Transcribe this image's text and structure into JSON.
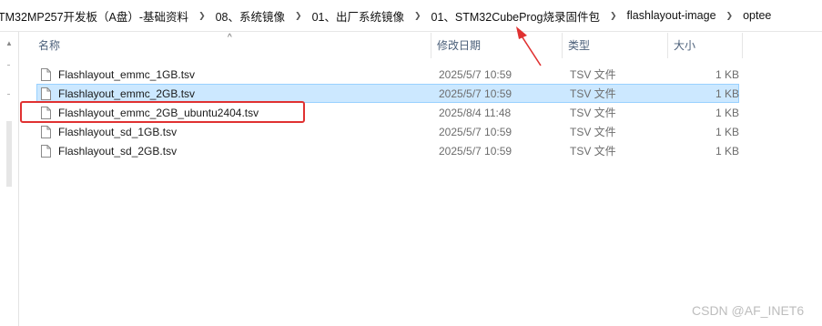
{
  "breadcrumb": [
    "TM32MP257开发板（A盘）-基础资料",
    "08、系统镜像",
    "01、出厂系统镜像",
    "01、STM32CubeProg烧录固件包",
    "flashlayout-image",
    "optee"
  ],
  "columns": {
    "name": "名称",
    "date": "修改日期",
    "type": "类型",
    "size": "大小"
  },
  "files": [
    {
      "name": "Flashlayout_emmc_1GB.tsv",
      "date": "2025/5/7 10:59",
      "type": "TSV 文件",
      "size": "1 KB",
      "selected": false
    },
    {
      "name": "Flashlayout_emmc_2GB.tsv",
      "date": "2025/5/7 10:59",
      "type": "TSV 文件",
      "size": "1 KB",
      "selected": true
    },
    {
      "name": "Flashlayout_emmc_2GB_ubuntu2404.tsv",
      "date": "2025/8/4 11:48",
      "type": "TSV 文件",
      "size": "1 KB",
      "selected": false
    },
    {
      "name": "Flashlayout_sd_1GB.tsv",
      "date": "2025/5/7 10:59",
      "type": "TSV 文件",
      "size": "1 KB",
      "selected": false
    },
    {
      "name": "Flashlayout_sd_2GB.tsv",
      "date": "2025/5/7 10:59",
      "type": "TSV 文件",
      "size": "1 KB",
      "selected": false
    }
  ],
  "icons": {
    "file": "document-icon",
    "separator": "chevron-right-icon",
    "sort": "sort-up-icon"
  },
  "colors": {
    "selection": "#cce8ff",
    "selection_border": "#99d1ff",
    "annotation": "#e03131",
    "header_text": "#4c607a"
  },
  "watermark": "CSDN @AF_INET6"
}
